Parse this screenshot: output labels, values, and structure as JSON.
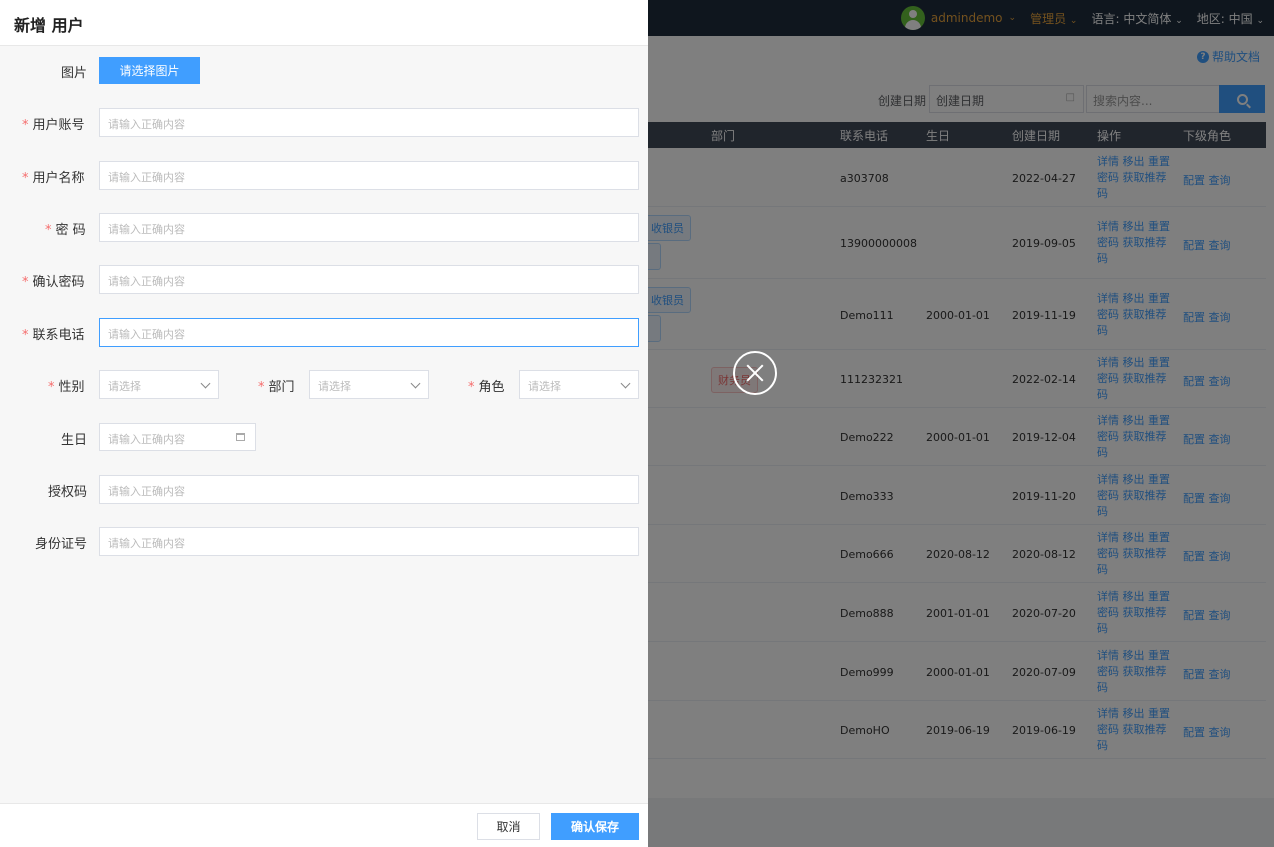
{
  "background": {
    "topbar": {
      "user": "admindemo",
      "role": "管理员",
      "language_label": "语言:",
      "language_value": "中文简体",
      "region_label": "地区:",
      "region_value": "中国"
    },
    "help_link": "帮助文档",
    "filter": {
      "date_label": "创建日期",
      "date_placeholder": "创建日期",
      "search_placeholder": "搜索内容..."
    },
    "table": {
      "headers": [
        "部门",
        "联系电话",
        "生日",
        "创建日期",
        "操作",
        "下级角色"
      ],
      "ops_text": "详情 移出 重置密码 获取推荐码",
      "subrole_text": "配置 查询",
      "rows": [
        {
          "phone": "a303708",
          "birthday": "",
          "created": "2022-04-27",
          "tag": ""
        },
        {
          "phone": "13900000008",
          "birthday": "",
          "created": "2019-09-05",
          "tag": "收银员"
        },
        {
          "phone": "Demo111",
          "birthday": "2000-01-01",
          "created": "2019-11-19",
          "tag": "收银员"
        },
        {
          "phone": "111232321",
          "birthday": "",
          "created": "2022-02-14",
          "tag": "财务员"
        },
        {
          "phone": "Demo222",
          "birthday": "2000-01-01",
          "created": "2019-12-04",
          "tag": ""
        },
        {
          "phone": "Demo333",
          "birthday": "",
          "created": "2019-11-20",
          "tag": ""
        },
        {
          "phone": "Demo666",
          "birthday": "2020-08-12",
          "created": "2020-08-12",
          "tag": ""
        },
        {
          "phone": "Demo888",
          "birthday": "2001-01-01",
          "created": "2020-07-20",
          "tag": ""
        },
        {
          "phone": "Demo999",
          "birthday": "2000-01-01",
          "created": "2020-07-09",
          "tag": ""
        },
        {
          "phone": "DemoHO",
          "birthday": "2019-06-19",
          "created": "2019-06-19",
          "tag": ""
        }
      ]
    }
  },
  "drawer": {
    "title": "新增 用户",
    "image_label": "图片",
    "upload_button": "请选择图片",
    "required_mark": "*",
    "fields": {
      "account": {
        "label": "用户账号",
        "placeholder": "请输入正确内容"
      },
      "name": {
        "label": "用户名称",
        "placeholder": "请输入正确内容"
      },
      "password": {
        "label": "密 码",
        "placeholder": "请输入正确内容"
      },
      "confirm_password": {
        "label": "确认密码",
        "placeholder": "请输入正确内容"
      },
      "phone": {
        "label": "联系电话",
        "placeholder": "请输入正确内容"
      },
      "gender": {
        "label": "性别",
        "placeholder": "请选择"
      },
      "department": {
        "label": "部门",
        "placeholder": "请选择"
      },
      "role": {
        "label": "角色",
        "placeholder": "请选择"
      },
      "birthday": {
        "label": "生日",
        "placeholder": "请输入正确内容"
      },
      "auth_code": {
        "label": "授权码",
        "placeholder": "请输入正确内容"
      },
      "id_number": {
        "label": "身份证号",
        "placeholder": "请输入正确内容"
      }
    },
    "cancel_button": "取消",
    "save_button": "确认保存"
  }
}
